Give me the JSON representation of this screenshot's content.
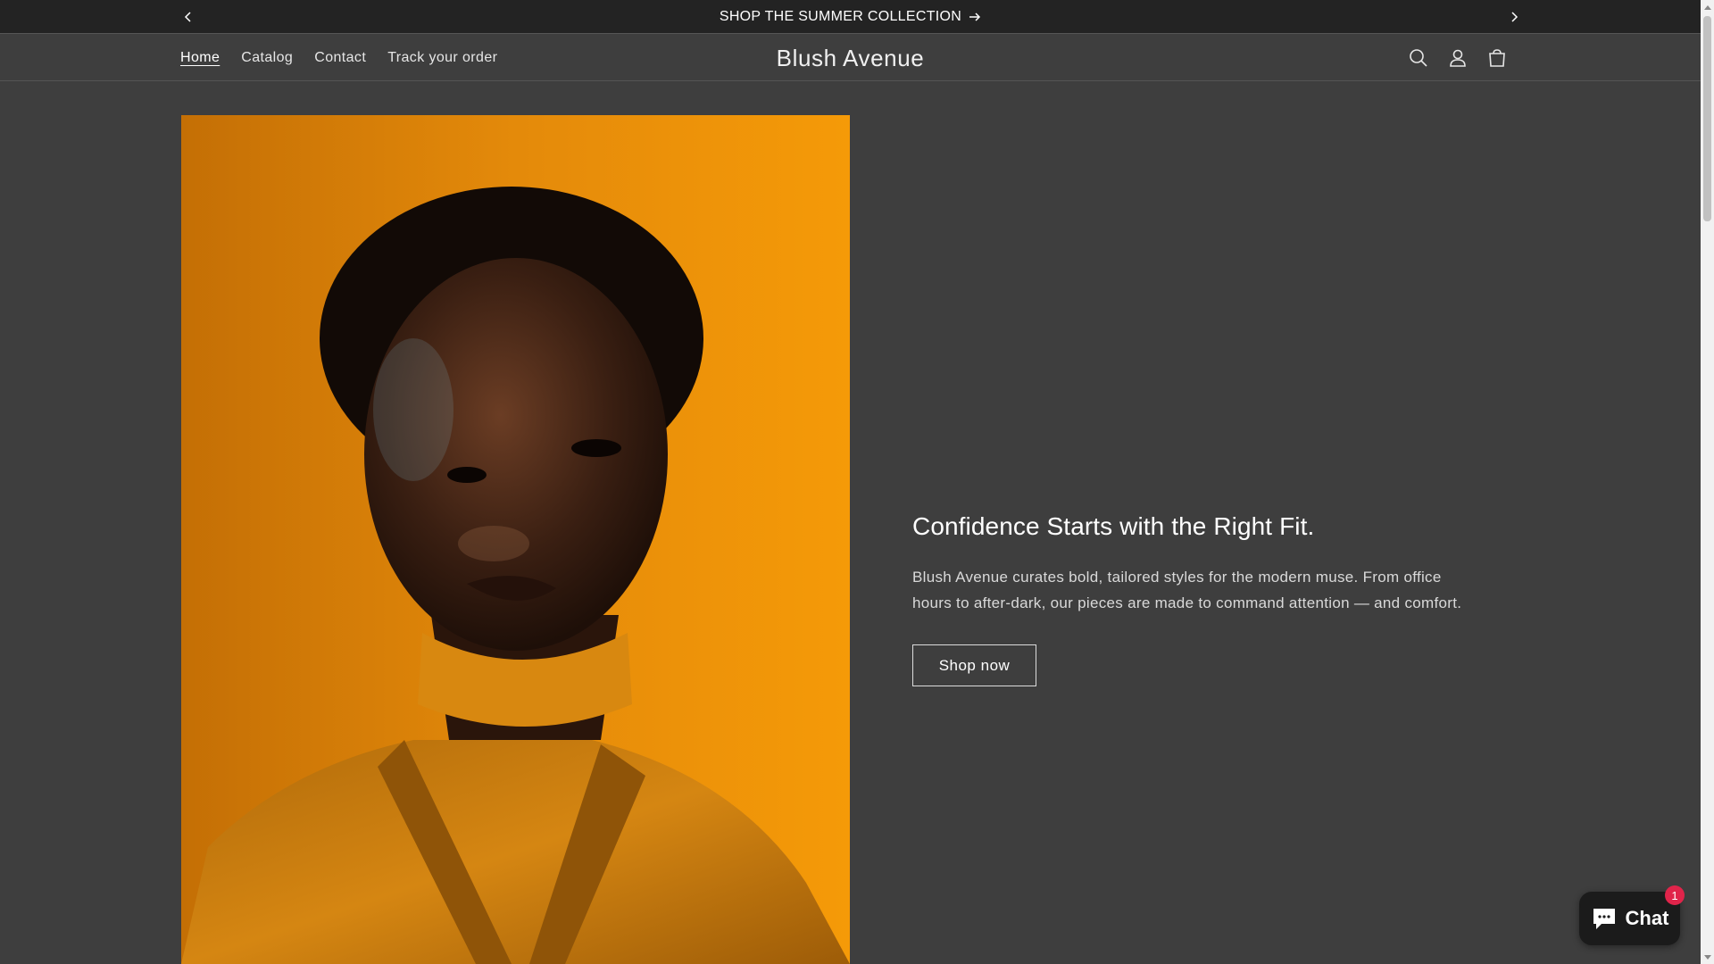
{
  "announcement": {
    "text": "SHOP THE SUMMER COLLECTION",
    "prev_icon": "chevron-left-icon",
    "next_icon": "chevron-right-icon"
  },
  "header": {
    "nav": [
      {
        "label": "Home",
        "active": true
      },
      {
        "label": "Catalog",
        "active": false
      },
      {
        "label": "Contact",
        "active": false
      },
      {
        "label": "Track your order",
        "active": false
      }
    ],
    "logo": "Blush Avenue",
    "icons": [
      "search-icon",
      "account-icon",
      "cart-icon"
    ]
  },
  "hero": {
    "title": "Confidence Starts with the Right Fit.",
    "description": "Blush Avenue curates bold, tailored styles for the modern muse. From office hours to after-dark, our pieces are made to command attention — and comfort.",
    "button": "Shop now"
  },
  "chat": {
    "label": "Chat",
    "badge": "1"
  },
  "colors": {
    "background": "#3e3e3e",
    "announcement_bar": "#232323",
    "hero_image_bg": "#e28a0a",
    "chat_bg": "#1b1b1b",
    "badge": "#e0244a"
  }
}
